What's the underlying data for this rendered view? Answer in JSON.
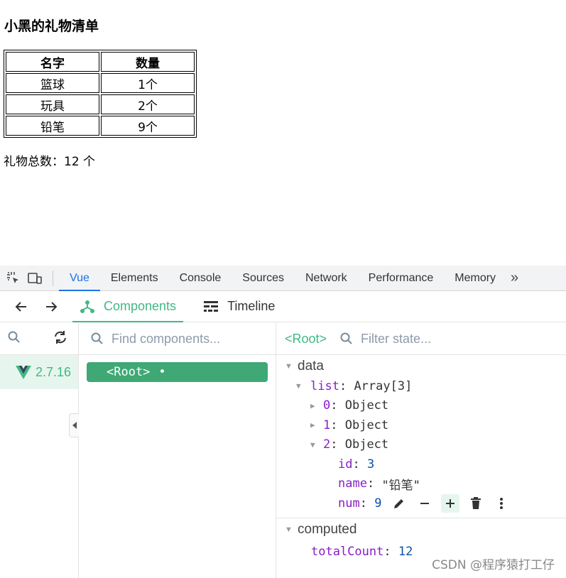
{
  "page": {
    "title": "小黑的礼物清单",
    "table": {
      "headers": [
        "名字",
        "数量"
      ],
      "rows": [
        [
          "篮球",
          "1个"
        ],
        [
          "玩具",
          "2个"
        ],
        [
          "铅笔",
          "9个"
        ]
      ]
    },
    "total_text": "礼物总数：12 个"
  },
  "devtools": {
    "tabs": [
      "Vue",
      "Elements",
      "Console",
      "Sources",
      "Network",
      "Performance",
      "Memory"
    ],
    "active_tab": "Vue",
    "more": "»",
    "vue_tabs": [
      "Components",
      "Timeline"
    ],
    "active_vue_tab": "Components",
    "app_version": "2.7.16",
    "find_placeholder": "Find components...",
    "root_node": "<Root>",
    "root_dot": "•",
    "selected": "<Root>",
    "filter_placeholder": "Filter state...",
    "data_section": "data",
    "computed_section": "computed",
    "state": {
      "list_key": "list",
      "list_type": "Array[3]",
      "items": [
        {
          "key": "0",
          "type": "Object"
        },
        {
          "key": "1",
          "type": "Object"
        },
        {
          "key": "2",
          "type": "Object"
        }
      ],
      "id_key": "id",
      "id_val": "3",
      "name_key": "name",
      "name_val": "\"铅笔\"",
      "num_key": "num",
      "num_val": "9",
      "total_key": "totalCount",
      "total_val": "12"
    },
    "colors": {
      "vue_green": "#42b883",
      "accent_blue": "#1a73e8",
      "key_purple": "#881ec7"
    }
  },
  "watermark": "CSDN @程序猿打工仔"
}
